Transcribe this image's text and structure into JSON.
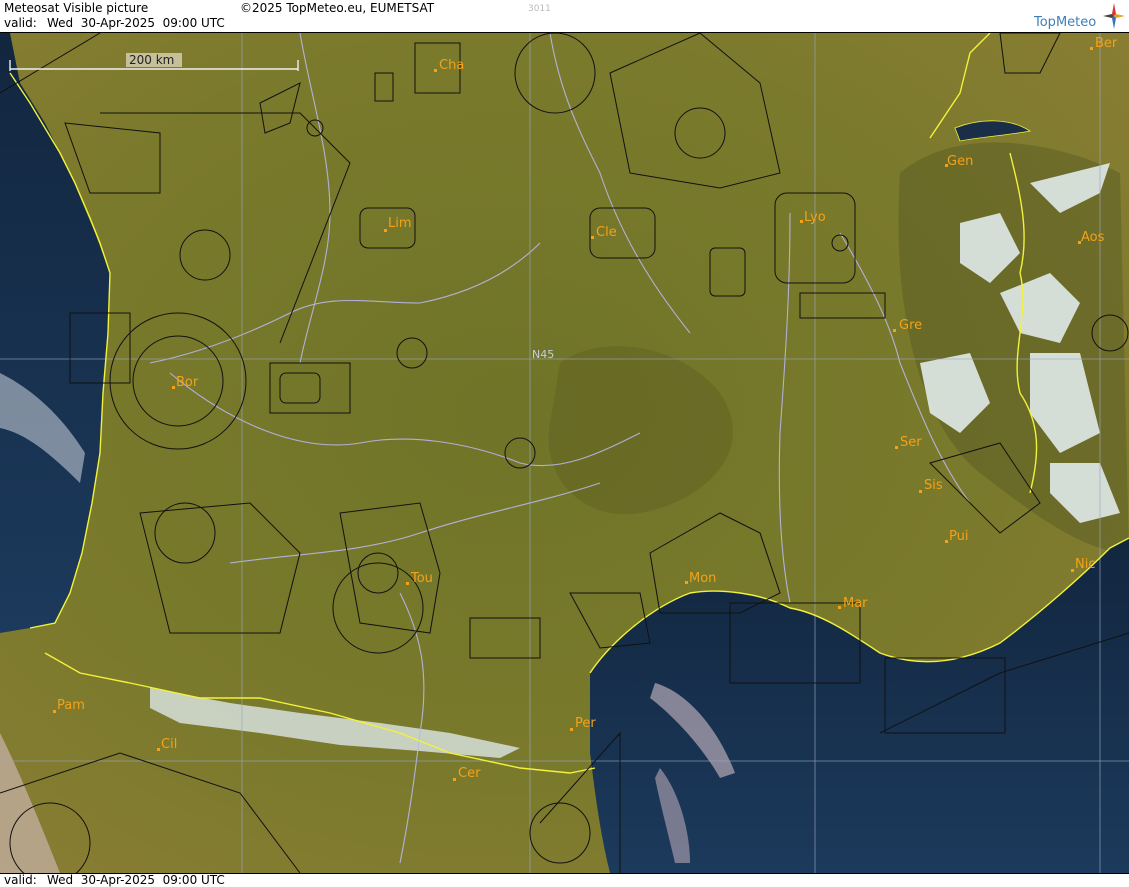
{
  "header": {
    "title": "Meteosat Visible picture",
    "copyright": "©2025 TopMeteo.eu, EUMETSAT",
    "code": "3011",
    "valid_label": "valid:",
    "valid_value": "Wed  30-Apr-2025  09:00 UTC",
    "logo_text": "TopMeteo"
  },
  "scale_bar": {
    "label": "200 km"
  },
  "grid": {
    "lat_label": "N45"
  },
  "cities": [
    {
      "code": "Cha"
    },
    {
      "code": "Ber"
    },
    {
      "code": "Gen"
    },
    {
      "code": "Lim"
    },
    {
      "code": "Cle"
    },
    {
      "code": "Lyo"
    },
    {
      "code": "Aos"
    },
    {
      "code": "Gre"
    },
    {
      "code": "Bor"
    },
    {
      "code": "Ser"
    },
    {
      "code": "Sis"
    },
    {
      "code": "Pui"
    },
    {
      "code": "Tou"
    },
    {
      "code": "Mon"
    },
    {
      "code": "Mar"
    },
    {
      "code": "Nic"
    },
    {
      "code": "Pam"
    },
    {
      "code": "Per"
    },
    {
      "code": "Cil"
    },
    {
      "code": "Cer"
    }
  ],
  "colors": {
    "land": "#7d7b2a",
    "land_dark": "#5f6220",
    "sea": "#17304f",
    "coast": "#f2f23a",
    "snow": "#dff0f4",
    "label": "#f3a21a",
    "airspace": "#111111",
    "river": "#b8b8e8"
  },
  "footer": {
    "valid_label": "valid:",
    "valid_value": "Wed  30-Apr-2025  09:00 UTC"
  }
}
